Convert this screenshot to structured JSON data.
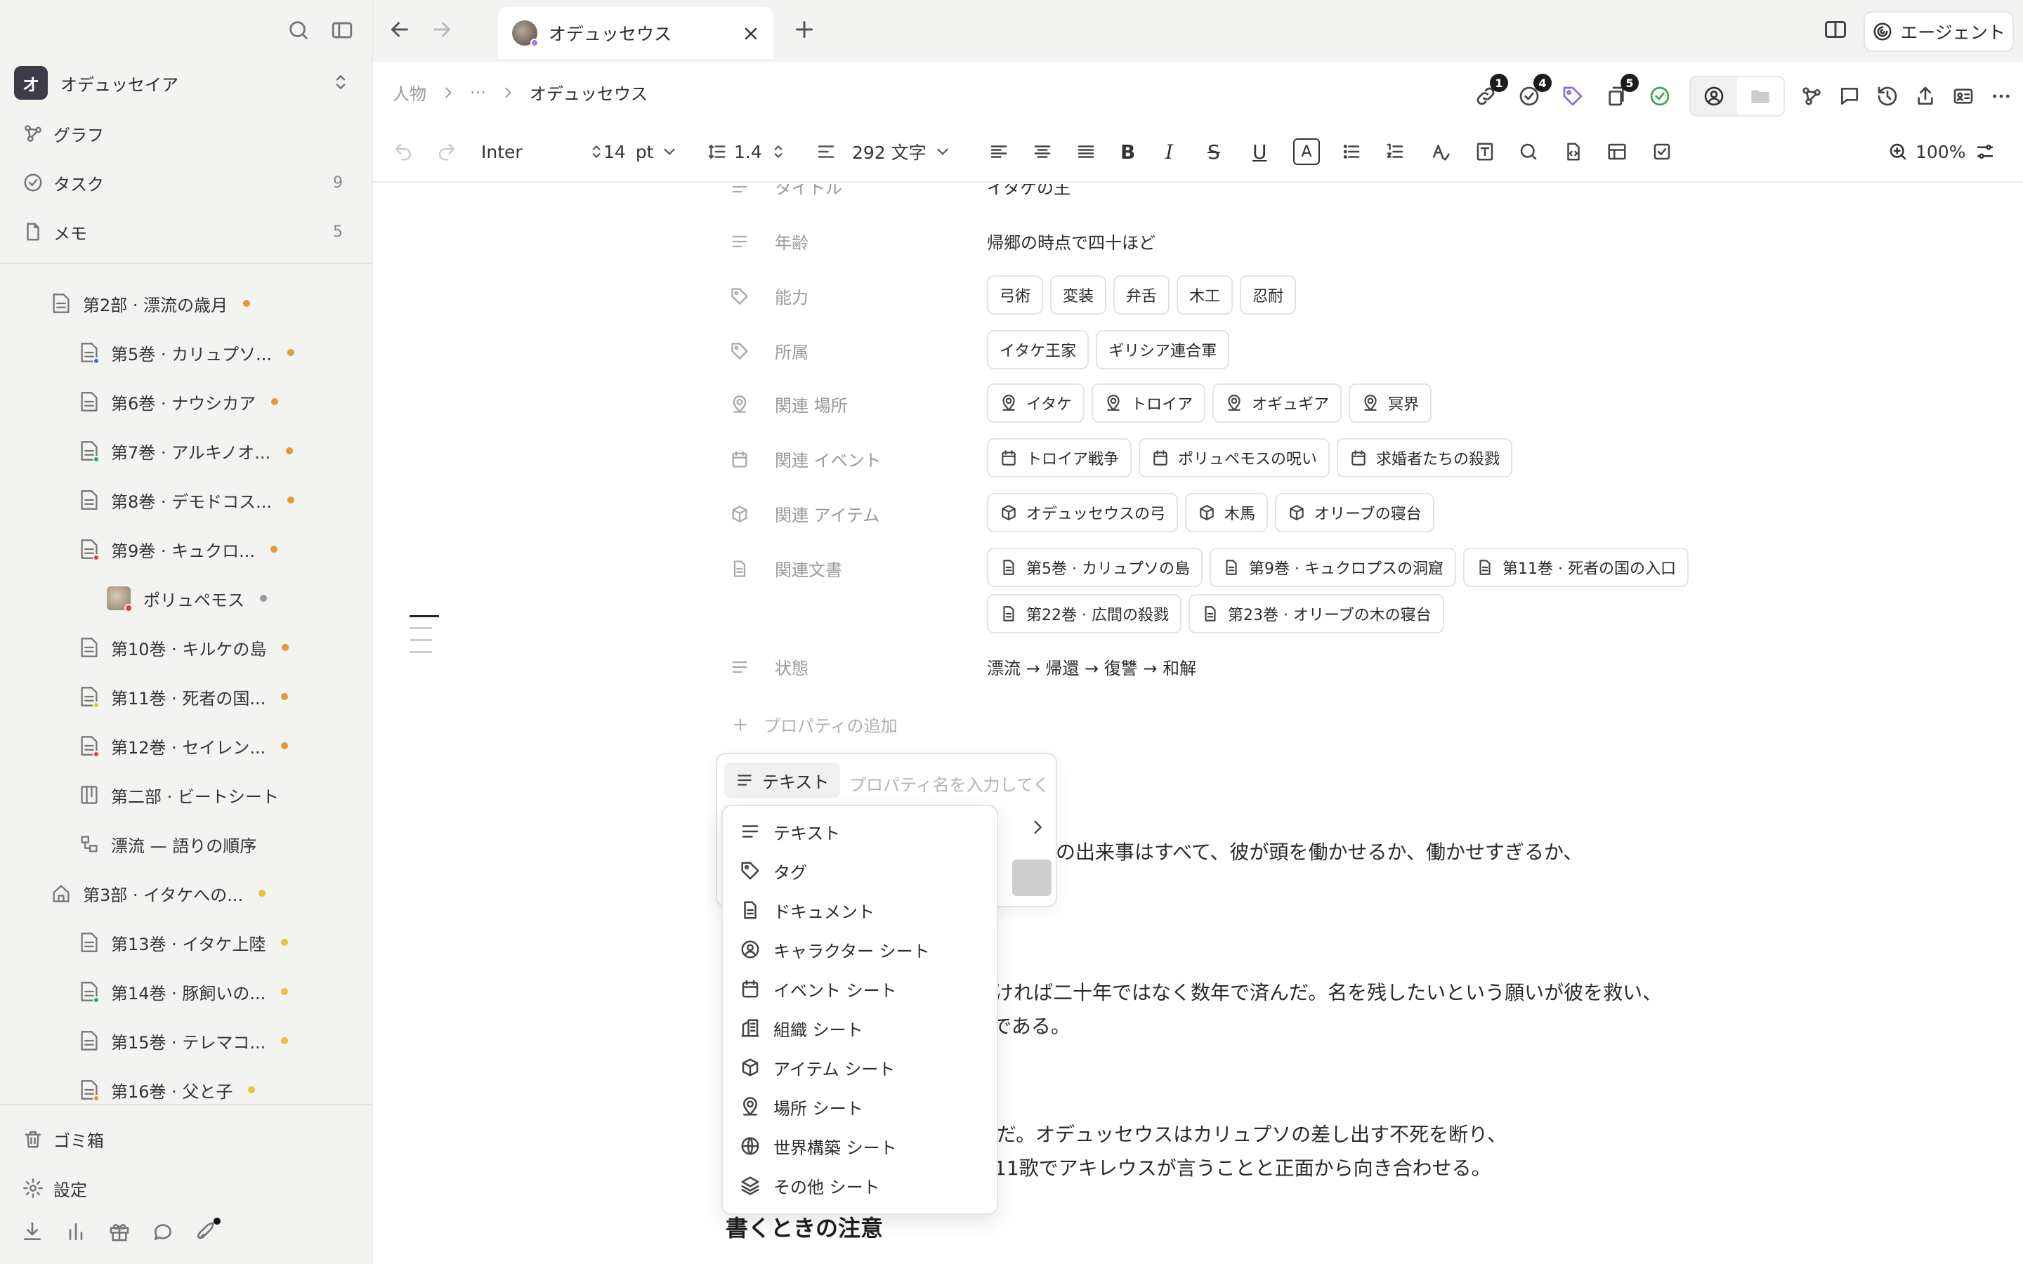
{
  "sidebar": {
    "workspace": {
      "avatar": "オ",
      "name": "オデュッセイア"
    },
    "nav": [
      {
        "label": "グラフ",
        "count": ""
      },
      {
        "label": "タスク",
        "count": "9"
      },
      {
        "label": "メモ",
        "count": "5"
      }
    ],
    "tree": [
      {
        "label": "第2部 · 漂流の歳月"
      },
      {
        "label": "第5巻 · カリュプソ..."
      },
      {
        "label": "第6巻 · ナウシカア"
      },
      {
        "label": "第7巻 · アルキノオ..."
      },
      {
        "label": "第8巻 · デモドコス..."
      },
      {
        "label": "第9巻 · キュクロ..."
      },
      {
        "label": "ポリュペモス"
      },
      {
        "label": "第10巻 · キルケの島"
      },
      {
        "label": "第11巻 · 死者の国..."
      },
      {
        "label": "第12巻 · セイレン..."
      },
      {
        "label": "第二部 · ビートシート"
      },
      {
        "label": "漂流 — 語りの順序"
      },
      {
        "label": "第3部 · イタケへの..."
      },
      {
        "label": "第13巻 · イタケ上陸"
      },
      {
        "label": "第14巻 · 豚飼いの..."
      },
      {
        "label": "第15巻 · テレマコ..."
      },
      {
        "label": "第16巻 · 父と子"
      }
    ],
    "trash": "ゴミ箱",
    "settings": "設定"
  },
  "tabs": {
    "active": "オデュッセウス"
  },
  "agent_label": "エージェント",
  "breadcrumb": {
    "root": "人物",
    "ellipsis": "···",
    "current": "オデュッセウス"
  },
  "header_badges": {
    "links": "1",
    "tasks": "4",
    "docs": "5"
  },
  "toolbar": {
    "font": "Inter",
    "size": "14",
    "unit": "pt",
    "line_height": "1.4",
    "word_count": "292 文字",
    "zoom": "100%"
  },
  "properties": {
    "title": {
      "label": "タイトル",
      "value": "イタケの王"
    },
    "age": {
      "label": "年齢",
      "value": "帰郷の時点で四十ほど"
    },
    "abilities": {
      "label": "能力",
      "tags": [
        "弓術",
        "変装",
        "弁舌",
        "木工",
        "忍耐"
      ]
    },
    "affiliation": {
      "label": "所属",
      "tags": [
        "イタケ王家",
        "ギリシア連合軍"
      ]
    },
    "places": {
      "label": "関連 場所",
      "items": [
        "イタケ",
        "トロイア",
        "オギュギア",
        "冥界"
      ]
    },
    "events": {
      "label": "関連 イベント",
      "items": [
        "トロイア戦争",
        "ポリュペモスの呪い",
        "求婚者たちの殺戮"
      ]
    },
    "items": {
      "label": "関連 アイテム",
      "items": [
        "オデュッセウスの弓",
        "木馬",
        "オリーブの寝台"
      ]
    },
    "docs": {
      "label": "関連文書",
      "items": [
        "第5巻 · カリュプソの島",
        "第9巻 · キュクロプスの洞窟",
        "第11巻 · 死者の国の入口",
        "第22巻 · 広間の殺戮",
        "第23巻 · オリーブの木の寝台"
      ]
    },
    "status": {
      "label": "状態",
      "value": "漂流 → 帰還 → 復讐 → 和解"
    },
    "add_label": "プロパティの追加"
  },
  "body": {
    "line1": "の出来事はすべて、彼が頭を働かせるか、働かせすぎるか、",
    "line2": "ければ二十年ではなく数年で済んだ。名を残したいという願いが彼を救い、",
    "line3": "いである。",
    "line4": "だ。オデュッセウスはカリュプソの差し出す不死を断り、",
    "line5": "11歌でアキレウスが言うことと正面から向き合わせる。",
    "heading": "書くときの注意"
  },
  "new_property": {
    "type_label": "テキスト",
    "placeholder": "プロパティ名を入力してく"
  },
  "type_menu": [
    "テキスト",
    "タグ",
    "ドキュメント",
    "キャラクター シート",
    "イベント シート",
    "組織 シート",
    "アイテム シート",
    "場所 シート",
    "世界構築 シート",
    "その他 シート"
  ]
}
